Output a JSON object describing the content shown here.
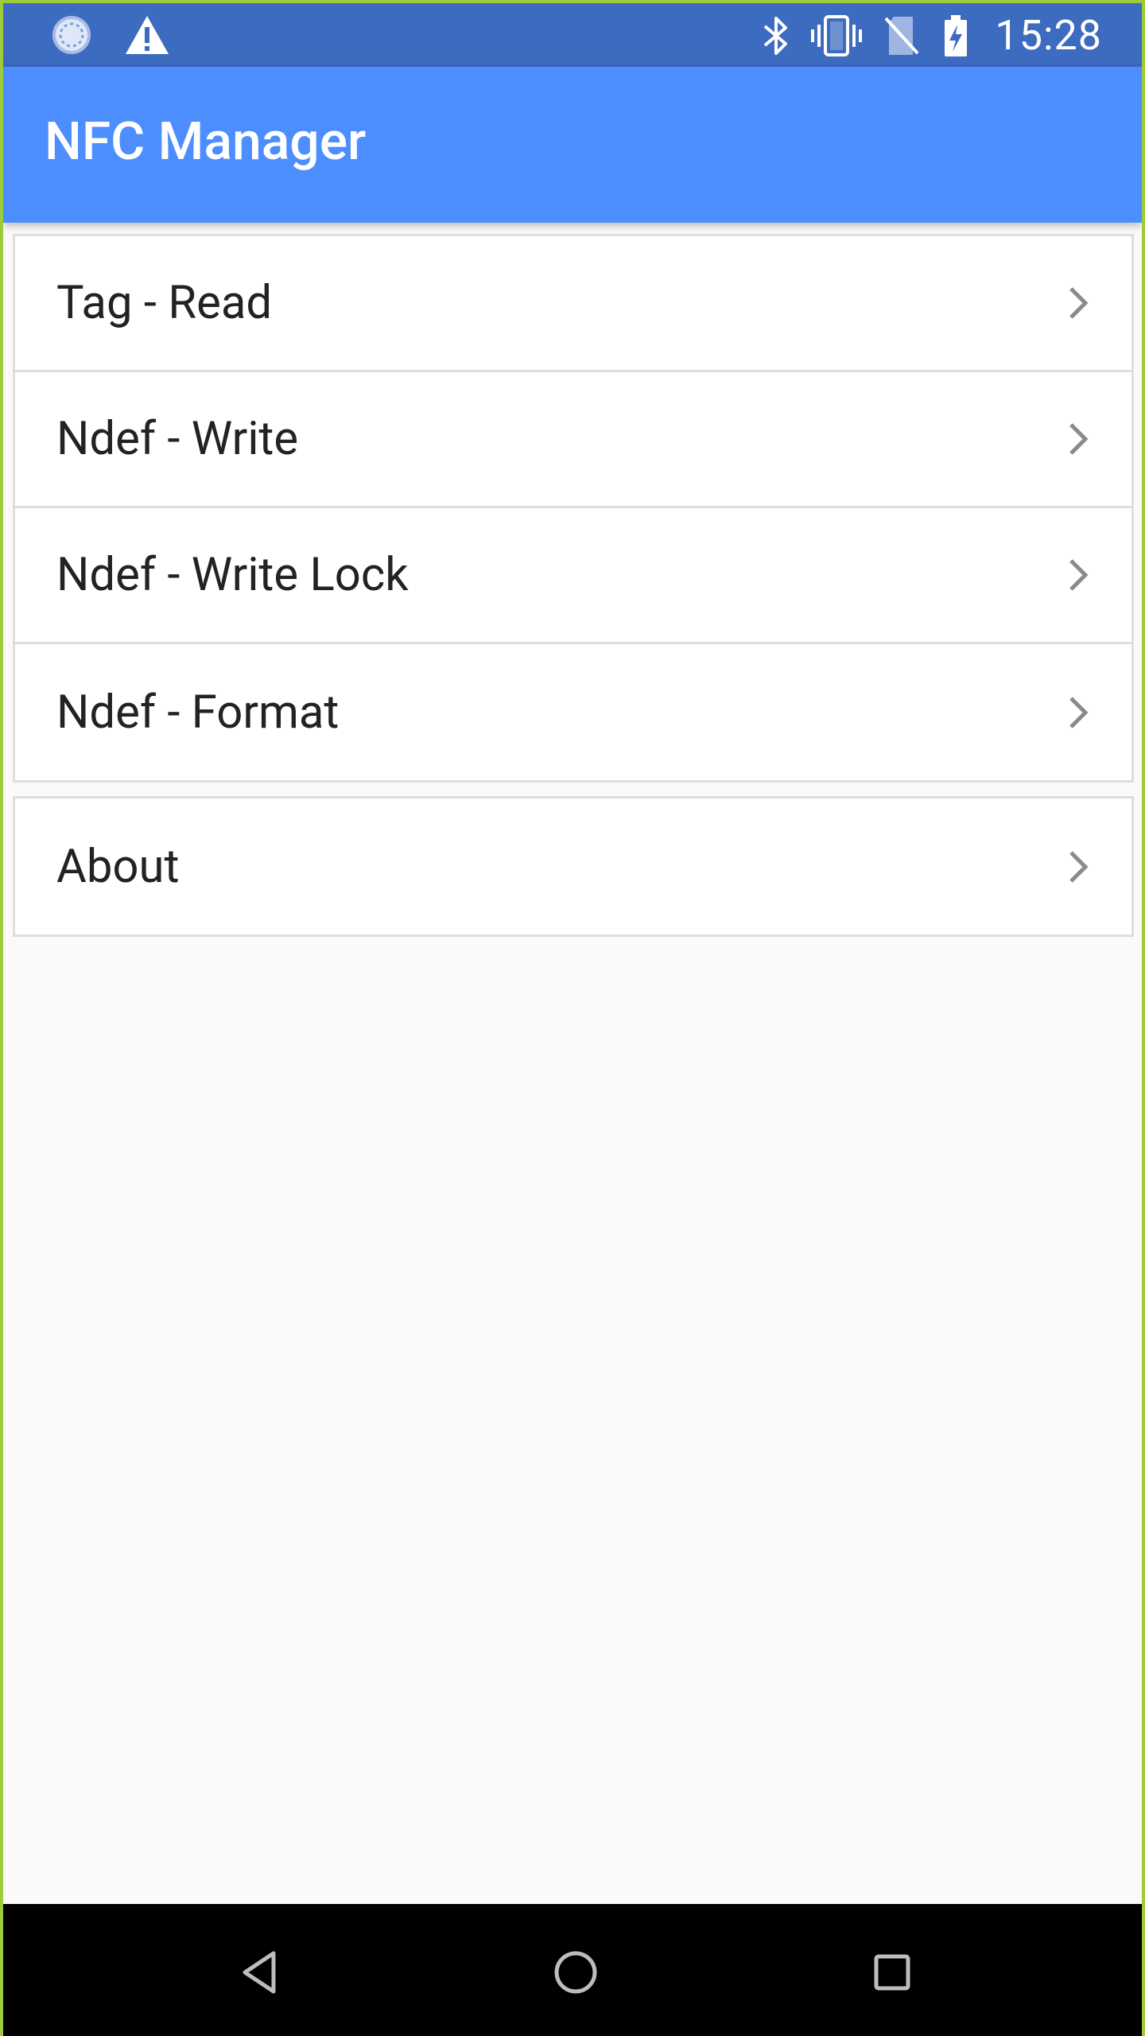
{
  "status_bar": {
    "time": "15:28",
    "left_icons": [
      "sync-circle-icon",
      "warning-icon"
    ],
    "right_icons": [
      "bluetooth-icon",
      "vibrate-icon",
      "no-sim-icon",
      "battery-charging-icon"
    ],
    "color": "#3d6bbf"
  },
  "app_bar": {
    "title": "NFC Manager",
    "color": "#4d8eff"
  },
  "menu": {
    "group1": [
      {
        "label": "Tag - Read"
      },
      {
        "label": "Ndef - Write"
      },
      {
        "label": "Ndef - Write Lock"
      },
      {
        "label": "Ndef - Format"
      }
    ],
    "group2": [
      {
        "label": "About"
      }
    ]
  },
  "nav_bar": {
    "buttons": [
      "back-icon",
      "home-icon",
      "recents-icon"
    ]
  }
}
